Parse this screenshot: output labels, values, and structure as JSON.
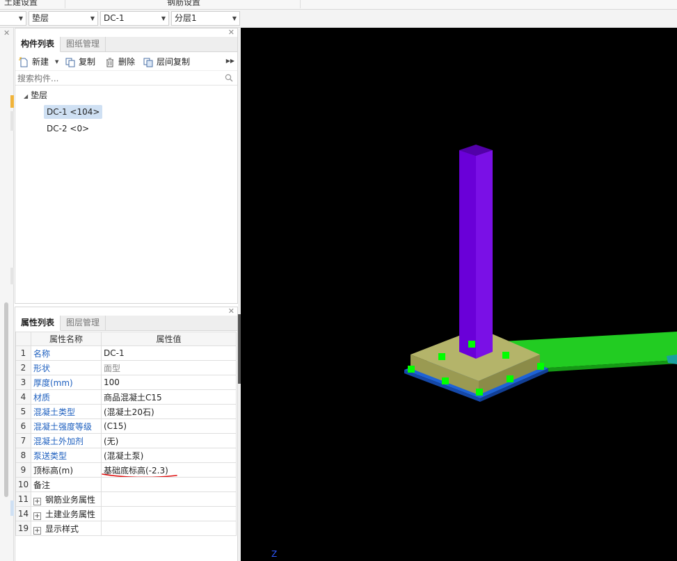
{
  "top_labels": [
    "土建设置",
    "钢筋设置"
  ],
  "dropdowns": {
    "type": "垫层",
    "component": "DC-1",
    "layer": "分层1"
  },
  "component_panel": {
    "tabs": [
      "构件列表",
      "图纸管理"
    ],
    "toolbar": {
      "new": "新建",
      "copy": "复制",
      "delete": "删除",
      "floor_copy": "层间复制"
    },
    "search_placeholder": "搜索构件...",
    "tree": {
      "group": "垫层",
      "items": [
        "DC-1 <104>",
        "DC-2 <0>"
      ]
    }
  },
  "property_panel": {
    "tabs": [
      "属性列表",
      "图层管理"
    ],
    "headers": [
      "属性名称",
      "属性值"
    ],
    "rows": [
      {
        "num": "1",
        "name": "名称",
        "value": "DC-1"
      },
      {
        "num": "2",
        "name": "形状",
        "value": "面型"
      },
      {
        "num": "3",
        "name": "厚度(mm)",
        "value": "100"
      },
      {
        "num": "4",
        "name": "材质",
        "value": "商品混凝土C15"
      },
      {
        "num": "5",
        "name": "混凝土类型",
        "value": "(混凝土20石)"
      },
      {
        "num": "6",
        "name": "混凝土强度等级",
        "value": "(C15)"
      },
      {
        "num": "7",
        "name": "混凝土外加剂",
        "value": "(无)"
      },
      {
        "num": "8",
        "name": "泵送类型",
        "value": "(混凝土泵)"
      },
      {
        "num": "9",
        "name": "顶标高(m)",
        "value": "基础底标高(-2.3)"
      },
      {
        "num": "10",
        "name": "备注",
        "value": ""
      },
      {
        "num": "11",
        "name": "钢筋业务属性",
        "value": ""
      },
      {
        "num": "14",
        "name": "土建业务属性",
        "value": ""
      },
      {
        "num": "19",
        "name": "显示样式",
        "value": ""
      }
    ]
  },
  "viewport": {
    "axis_label": "Z",
    "colors": {
      "background": "#000000",
      "column": "#6a00d8",
      "footing": "#b4b46a",
      "cushion": "#1e63d6",
      "beam": "#22cc22",
      "grip_point": "#00ff00",
      "annotation": "#e01010"
    }
  }
}
